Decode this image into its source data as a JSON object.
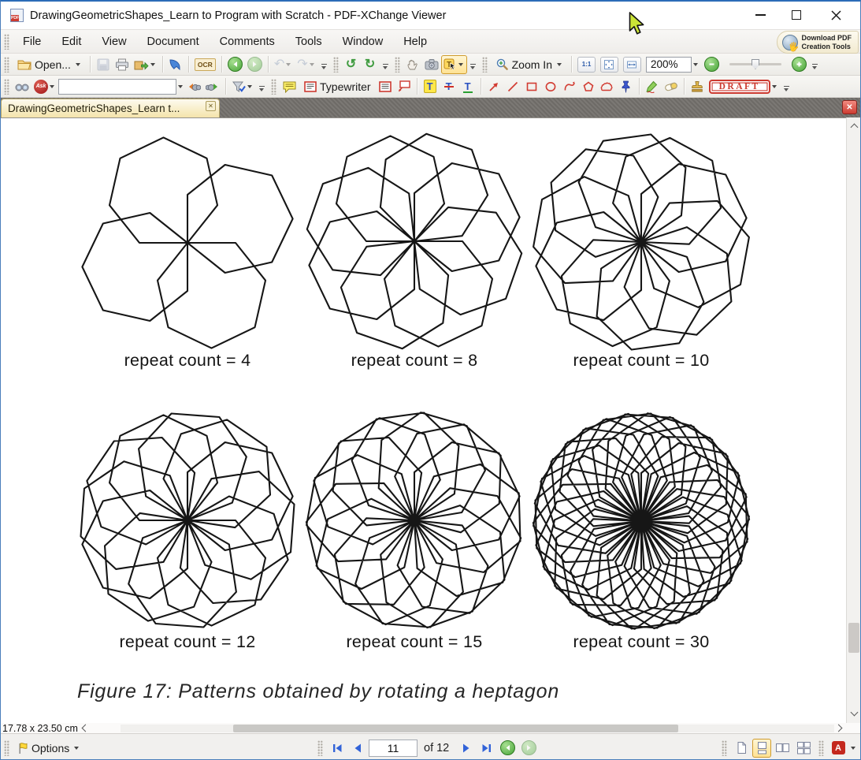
{
  "window": {
    "title": "DrawingGeometricShapes_Learn to Program with Scratch - PDF-XChange Viewer"
  },
  "menu_items": [
    "File",
    "Edit",
    "View",
    "Document",
    "Comments",
    "Tools",
    "Window",
    "Help"
  ],
  "promo": {
    "line1": "Download PDF",
    "line2": "Creation Tools"
  },
  "toolbar": {
    "open": "Open...",
    "ocr": "OCR",
    "zoom_in": "Zoom In",
    "zoom_level": "200%",
    "actual_size": "1:1",
    "ask": "Ask",
    "search_value": "",
    "typewriter": "Typewriter",
    "draft": "DRAFT"
  },
  "icons": {
    "undo": "↶",
    "redo": "↷",
    "rotate_ccw": "↺",
    "rotate_cw": "↻",
    "highlight_glyph": "T",
    "strikeout_glyph": "T",
    "underline_glyph": "T",
    "adobe_glyph": "A",
    "hand_cursor": "☝"
  },
  "tab": {
    "title": "DrawingGeometricShapes_Learn t..."
  },
  "document": {
    "shape": "heptagon",
    "shape_sides": 7,
    "figures": [
      {
        "repeat_count": 4,
        "caption": "repeat count = 4"
      },
      {
        "repeat_count": 8,
        "caption": "repeat count = 8"
      },
      {
        "repeat_count": 10,
        "caption": "repeat count = 10"
      },
      {
        "repeat_count": 12,
        "caption": "repeat count = 12"
      },
      {
        "repeat_count": 15,
        "caption": "repeat count = 15"
      },
      {
        "repeat_count": 30,
        "caption": "repeat count = 30"
      }
    ],
    "figure_caption": "Figure 17: Patterns obtained by rotating a heptagon"
  },
  "statusbar": {
    "page_size": "17.78 x 23.50 cm",
    "options": "Options",
    "current_page": "11",
    "of_pages": "of 12"
  },
  "colors": {
    "active_tool_bg": "#ffe293",
    "tab_bg": "#f4e4ab",
    "tabbar_bg": "#757270",
    "draft_red": "#cc3a30",
    "annotation_red": "#d23c32",
    "nav_blue": "#3263d8",
    "nav_green": "#47a437",
    "stroke_black": "#161616"
  }
}
